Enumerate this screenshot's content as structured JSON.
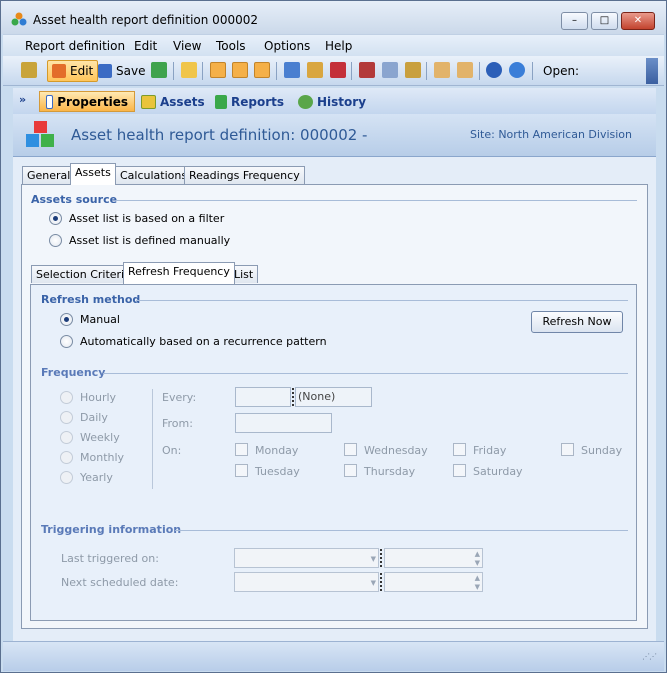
{
  "window": {
    "title": "Asset health report definition 000002",
    "min": "–",
    "max": "□",
    "close": "✕"
  },
  "menu": [
    "Report definition",
    "Edit",
    "View",
    "Tools",
    "Options",
    "Help"
  ],
  "toolbar": {
    "edit": "Edit",
    "save": "Save",
    "open": "Open:"
  },
  "nav": {
    "properties": "Properties",
    "assets": "Assets",
    "reports": "Reports",
    "history": "History"
  },
  "header": {
    "title": "Asset health report definition: 000002 -",
    "site": "Site: North American Division"
  },
  "main_tabs": [
    "General",
    "Assets",
    "Calculations",
    "Readings Frequency"
  ],
  "assets_source": {
    "title": "Assets source",
    "opt_filter": "Asset list is based on a filter",
    "opt_manual": "Asset list is defined manually"
  },
  "sub_tabs": [
    "Selection Criteria",
    "Refresh Frequency",
    "List"
  ],
  "refresh_method": {
    "title": "Refresh method",
    "manual": "Manual",
    "auto": "Automatically based on a recurrence pattern",
    "button": "Refresh Now"
  },
  "frequency": {
    "title": "Frequency",
    "options": [
      "Hourly",
      "Daily",
      "Weekly",
      "Monthly",
      "Yearly"
    ],
    "every": "Every:",
    "every_unit": "(None)",
    "from": "From:",
    "on": "On:",
    "days": [
      "Monday",
      "Wednesday",
      "Friday",
      "Sunday",
      "Tuesday",
      "Thursday",
      "Saturday"
    ]
  },
  "triggering": {
    "title": "Triggering information",
    "last": "Last triggered on:",
    "next": "Next scheduled date:"
  },
  "colors": {
    "accent": "#3a63a8",
    "active_tab": "#fbb548",
    "band": "#c9dcef"
  }
}
